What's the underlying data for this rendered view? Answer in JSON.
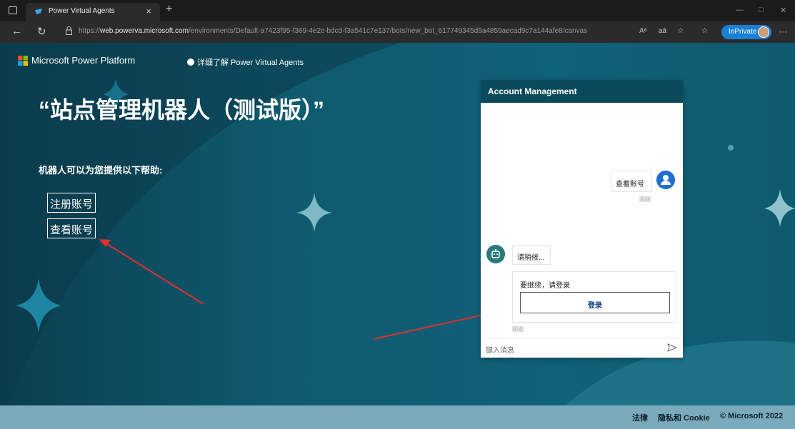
{
  "browser": {
    "tab_title": "Power Virtual Agents",
    "tab_close": "×",
    "new_tab": "+",
    "url_prefix": "https://",
    "url_host": "web.powerva.microsoft.com",
    "url_path": "/environments/Default-a7423f95-f369-4e2c-bdcd-f3a541c7e137/bots/new_bot_617749345d9a4859aecad9c7a144afe8/canvas",
    "inprivate_label": "InPrivate",
    "more_label": "···",
    "read_aloud": "Aᵃ",
    "translate": "aā"
  },
  "header": {
    "brand": "Microsoft Power Platform",
    "learn_more": "详细了解 Power Virtual Agents"
  },
  "main": {
    "headline": "“站点管理机器人（测试版）”",
    "subline": "机器人可以为您提供以下帮助:",
    "options": [
      "注册账号",
      "查看账号"
    ]
  },
  "chat": {
    "title": "Account Management",
    "user_message": "查看账号",
    "user_time": "刚刚",
    "bot_message": "请稍候...",
    "login_prompt": "要继续，请登录",
    "login_button": "登录",
    "bot_time": "刚刚",
    "input_placeholder": "键入消息"
  },
  "footer": {
    "legal": "法律",
    "privacy": "隐私和 Cookie",
    "copyright": "© Microsoft 2022"
  },
  "colors": {
    "page_bg": "#0f5a6e",
    "chat_header": "#0b4a5c",
    "footer_bg": "#7aaabb",
    "annotation_arrow": "#e03030"
  }
}
